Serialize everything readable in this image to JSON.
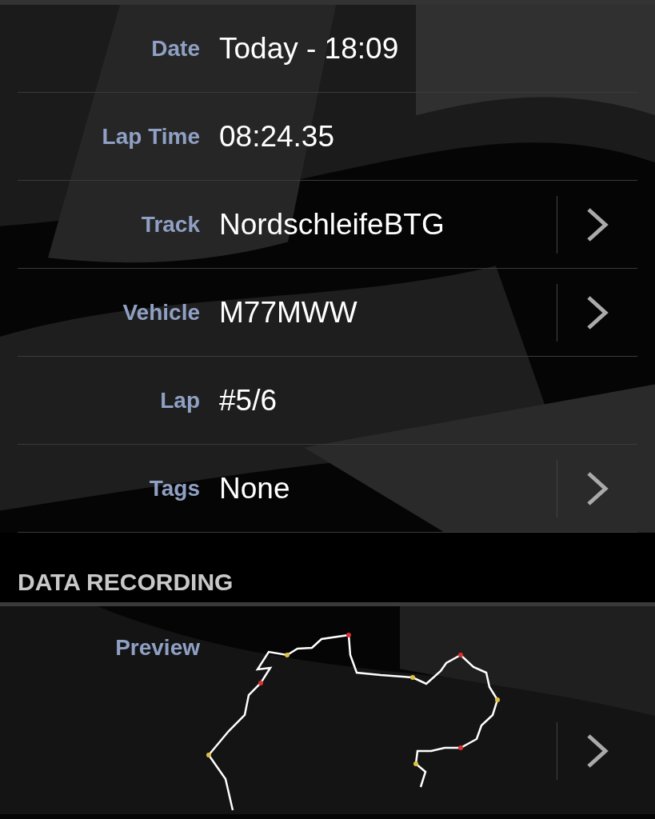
{
  "details": [
    {
      "label": "Date",
      "value": "Today - 18:09",
      "navigable": false
    },
    {
      "label": "Lap Time",
      "value": "08:24.35",
      "navigable": false
    },
    {
      "label": "Track",
      "value": "NordschleifeBTG",
      "navigable": true
    },
    {
      "label": "Vehicle",
      "value": "M77MWW",
      "navigable": true
    },
    {
      "label": "Lap",
      "value": "#5/6",
      "navigable": false
    },
    {
      "label": "Tags",
      "value": "None",
      "navigable": true
    }
  ],
  "section": {
    "title": "DATA RECORDING"
  },
  "preview": {
    "label": "Preview",
    "navigable": true
  }
}
